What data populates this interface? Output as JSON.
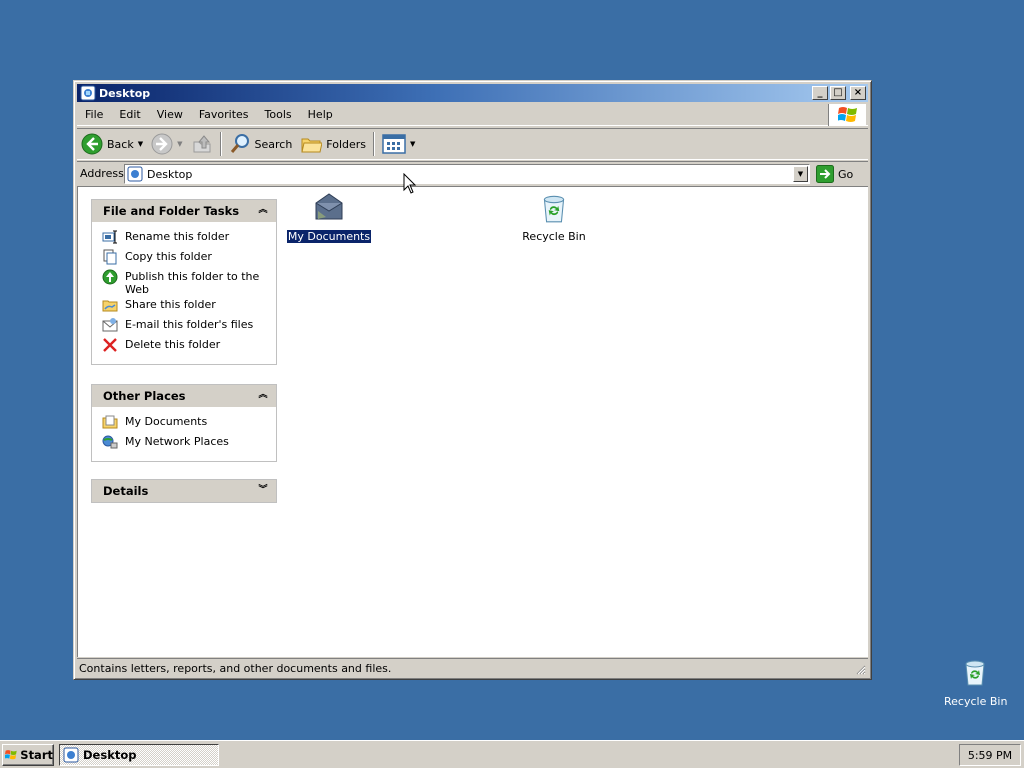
{
  "window": {
    "title": "Desktop",
    "buttons": {
      "minimize": "_",
      "maximize": "□",
      "close": "×"
    }
  },
  "menu": [
    "File",
    "Edit",
    "View",
    "Favorites",
    "Tools",
    "Help"
  ],
  "toolbar": {
    "back_label": "Back",
    "search_label": "Search",
    "folders_label": "Folders"
  },
  "address": {
    "label": "Address",
    "value": "Desktop",
    "go_label": "Go"
  },
  "task_panes": {
    "file_folder_tasks": {
      "title": "File and Folder Tasks",
      "items": [
        "Rename this folder",
        "Copy this folder",
        "Publish this folder to the Web",
        "Share this folder",
        "E-mail this folder's files",
        "Delete this folder"
      ]
    },
    "other_places": {
      "title": "Other Places",
      "items": [
        "My Documents",
        "My Network Places"
      ]
    },
    "details": {
      "title": "Details"
    }
  },
  "files": [
    {
      "label": "My Documents",
      "selected": true
    },
    {
      "label": "Recycle Bin",
      "selected": false
    }
  ],
  "status_text": "Contains letters, reports, and other documents and files.",
  "desktop": {
    "recycle_bin_label": "Recycle Bin"
  },
  "taskbar": {
    "start_label": "Start",
    "task_label": "Desktop",
    "clock": "5:59 PM"
  },
  "colors": {
    "desktop": "#3a6ea5",
    "title_start": "#0a246a",
    "title_end": "#a6caf0",
    "face": "#d4d0c8",
    "selection": "#0a246a"
  }
}
